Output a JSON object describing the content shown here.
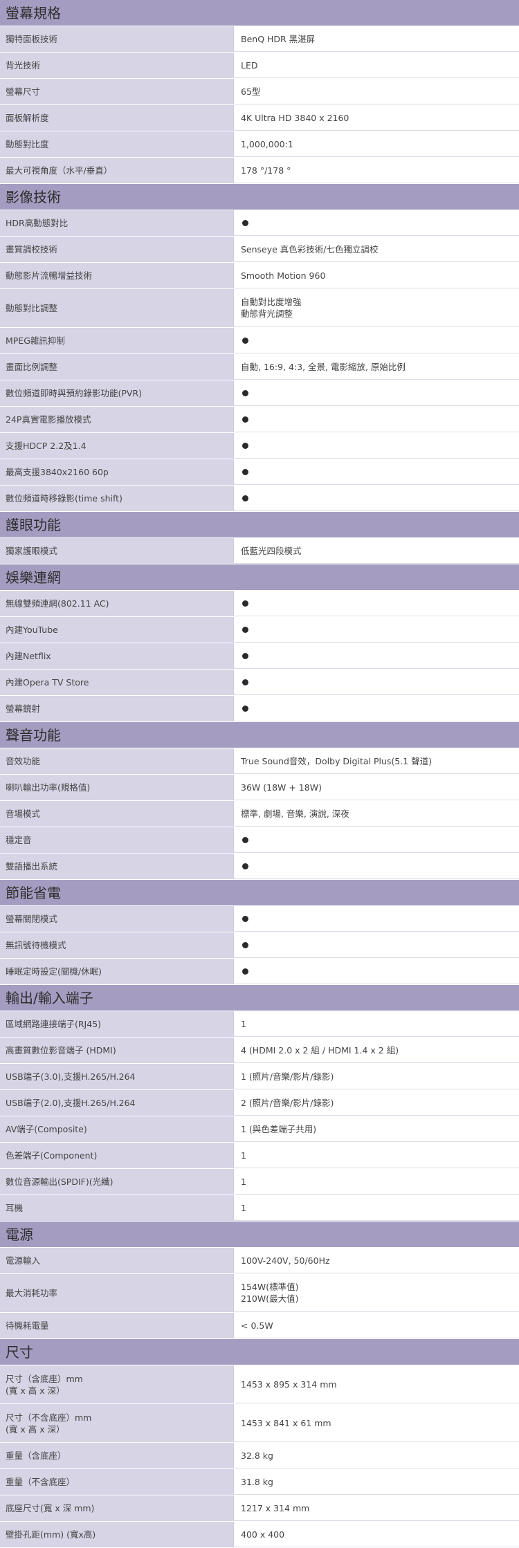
{
  "sections": [
    {
      "title": "螢幕規格",
      "rows": [
        {
          "label": [
            "獨特面板技術"
          ],
          "value": [
            "BenQ HDR 黑湛屏"
          ]
        },
        {
          "label": [
            "背光技術"
          ],
          "value": [
            "LED"
          ]
        },
        {
          "label": [
            "螢幕尺寸"
          ],
          "value": [
            "65型"
          ]
        },
        {
          "label": [
            "面板解析度"
          ],
          "value": [
            "4K Ultra HD 3840 x 2160"
          ]
        },
        {
          "label": [
            "動態對比度"
          ],
          "value": [
            "1,000,000:1"
          ]
        },
        {
          "label": [
            "最大可視角度（水平/垂直）"
          ],
          "value": [
            "178 °/178 °"
          ]
        }
      ]
    },
    {
      "title": "影像技術",
      "rows": [
        {
          "label": [
            "HDR高動態對比"
          ],
          "dot": true
        },
        {
          "label": [
            "畫質調校技術"
          ],
          "value": [
            "Senseye 真色彩技術/七色獨立調校"
          ]
        },
        {
          "label": [
            "動態影片流暢增益技術"
          ],
          "value": [
            "Smooth Motion 960"
          ]
        },
        {
          "label": [
            "動態對比調整"
          ],
          "value": [
            "自動對比度增強",
            "動態背光調整"
          ]
        },
        {
          "label": [
            "MPEG雜訊抑制"
          ],
          "dot": true
        },
        {
          "label": [
            "畫面比例調整"
          ],
          "value": [
            "自動, 16:9, 4:3, 全景, 電影縮放, 原始比例"
          ]
        },
        {
          "label": [
            "數位頻道即時與預約錄影功能(PVR)"
          ],
          "dot": true
        },
        {
          "label": [
            "24P真實電影播放模式"
          ],
          "dot": true
        },
        {
          "label": [
            "支援HDCP 2.2及1.4"
          ],
          "dot": true
        },
        {
          "label": [
            "最高支援3840x2160 60p"
          ],
          "dot": true
        },
        {
          "label": [
            "數位頻道時移錄影(time shift)"
          ],
          "dot": true
        }
      ]
    },
    {
      "title": "護眼功能",
      "rows": [
        {
          "label": [
            "獨家護眼模式"
          ],
          "value": [
            "低藍光四段模式"
          ]
        }
      ]
    },
    {
      "title": "娛樂連網",
      "rows": [
        {
          "label": [
            "無線雙頻連網(802.11 AC)"
          ],
          "dot": true
        },
        {
          "label": [
            "內建YouTube"
          ],
          "dot": true
        },
        {
          "label": [
            "內建Netflix"
          ],
          "dot": true
        },
        {
          "label": [
            "內建Opera TV Store"
          ],
          "dot": true
        },
        {
          "label": [
            "螢幕鏡射"
          ],
          "dot": true
        }
      ]
    },
    {
      "title": "聲音功能",
      "rows": [
        {
          "label": [
            "音效功能"
          ],
          "value": [
            "True Sound音效，Dolby Digital Plus(5.1 聲道)"
          ]
        },
        {
          "label": [
            "喇叭輸出功率(規格值)"
          ],
          "value": [
            "36W (18W + 18W)"
          ]
        },
        {
          "label": [
            "音場模式"
          ],
          "value": [
            "標準, 劇場, 音樂, 演說, 深夜"
          ]
        },
        {
          "label": [
            "穩定音"
          ],
          "dot": true
        },
        {
          "label": [
            "雙語播出系統"
          ],
          "dot": true
        }
      ]
    },
    {
      "title": "節能省電",
      "rows": [
        {
          "label": [
            "螢幕關閉模式"
          ],
          "dot": true
        },
        {
          "label": [
            "無訊號待機模式"
          ],
          "dot": true
        },
        {
          "label": [
            "睡眠定時設定(關機/休眠)"
          ],
          "dot": true
        }
      ]
    },
    {
      "title": "輸出/輸入端子",
      "rows": [
        {
          "label": [
            "區域網路連接端子(RJ45)"
          ],
          "value": [
            "1"
          ]
        },
        {
          "label": [
            "高畫質數位影音端子 (HDMI)"
          ],
          "value": [
            "4 (HDMI 2.0 x 2 組 / HDMI 1.4 x 2 組)"
          ]
        },
        {
          "label": [
            "USB端子(3.0),支援H.265/H.264"
          ],
          "value": [
            "1 (照片/音樂/影片/錄影)"
          ]
        },
        {
          "label": [
            "USB端子(2.0),支援H.265/H.264"
          ],
          "value": [
            "2 (照片/音樂/影片/錄影)"
          ]
        },
        {
          "label": [
            "AV端子(Composite)"
          ],
          "value": [
            "1 (與色差端子共用)"
          ]
        },
        {
          "label": [
            "色差端子(Component)"
          ],
          "value": [
            "1"
          ]
        },
        {
          "label": [
            "數位音源輸出(SPDIF)(光纖)"
          ],
          "value": [
            "1"
          ]
        },
        {
          "label": [
            "耳機"
          ],
          "value": [
            "1"
          ]
        }
      ]
    },
    {
      "title": "電源",
      "rows": [
        {
          "label": [
            "電源輸入"
          ],
          "value": [
            "100V-240V, 50/60Hz"
          ]
        },
        {
          "label": [
            "最大消耗功率"
          ],
          "value": [
            "154W(標準值)",
            "210W(最大值)"
          ]
        },
        {
          "label": [
            "待機耗電量"
          ],
          "value": [
            "< 0.5W"
          ]
        }
      ]
    },
    {
      "title": "尺寸",
      "rows": [
        {
          "label": [
            "尺寸（含底座）mm",
            "(寬 x 高 x 深）"
          ],
          "value": [
            "1453 x 895 x 314 mm"
          ]
        },
        {
          "label": [
            "尺寸（不含底座）mm",
            "(寬 x 高 x 深）"
          ],
          "value": [
            "1453 x 841 x 61 mm"
          ]
        },
        {
          "label": [
            "重量（含底座）"
          ],
          "value": [
            "32.8 kg"
          ]
        },
        {
          "label": [
            "重量（不含底座）"
          ],
          "value": [
            "31.8 kg"
          ]
        },
        {
          "label": [
            "底座尺寸(寬 x 深 mm)"
          ],
          "value": [
            "1217 x 314 mm"
          ]
        },
        {
          "label": [
            "壁掛孔距(mm) (寬x高)"
          ],
          "value": [
            "400 x 400"
          ]
        }
      ]
    }
  ]
}
